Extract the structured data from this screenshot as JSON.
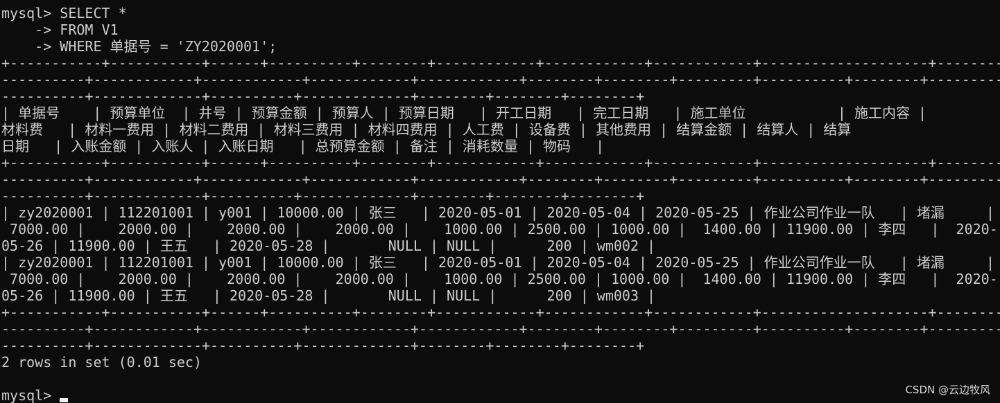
{
  "terminal": {
    "lines": [
      "mysql> SELECT *",
      "    -> FROM V1",
      "    -> WHERE 单据号 = 'ZY2020001';",
      "+-----------+-----------+------+----------+--------+------------+------------+------------+--------------------+----------+",
      "----------+------------+------------+------------+------------+--------+--------+---------+----------+--------+----------+",
      "| 单据号    | 预算单位  | 井号 | 预算金额 | 预算人 | 预算日期   | 开工日期   | 完工日期   | 施工单位           | 施工内容 |",
      "材料费   | 材料一费用 | 材料二费用 | 材料三费用 | 材料四费用 | 人工费 | 设备费 | 其他费用 | 结算金额 | 结算人 | 结算",
      "日期   | 入账金额 | 入账人 | 入账日期   | 总预算金额 | 备注 | 消耗数量 | 物码   |",
      "+-----------+-----------+------+----------+--------+------------+------------+------------+--------------------+----------+",
      "----------+------------+------------+------------+------------+--------+--------+---------+----------+--------+----------+",
      "----------+-------------+----------+-------------+--------+--------+--------+",
      "| zy2020001 | 112201001 | y001 | 10000.00 | 张三   | 2020-05-01 | 2020-05-04 | 2020-05-25 | 作业公司作业一队   | 堵漏     |",
      " 7000.00 |    2000.00 |    2000.00 |    2000.00 |    1000.00 | 2500.00 | 1000.00 |  1400.00 | 11900.00 | 李四   |  2020-",
      "05-26 | 11900.00 | 王五   | 2020-05-28 |       NULL | NULL |      200 | wm002 |",
      "| zy2020001 | 112201001 | y001 | 10000.00 | 张三   | 2020-05-01 | 2020-05-04 | 2020-05-25 | 作业公司作业一队   | 堵漏     |",
      " 7000.00 |    2000.00 |    2000.00 |    2000.00 |    1000.00 | 2500.00 | 1000.00 |  1400.00 | 11900.00 | 李四   |  2020-",
      "05-26 | 11900.00 | 王五   | 2020-05-28 |       NULL | NULL |      200 | wm003 |",
      "+-----------+-----------+------+----------+--------+------------+------------+------------+--------------------+----------+",
      "----------+------------+------------+------------+------------+--------+--------+---------+----------+--------+----------+",
      "----------+-------------+----------+-------------+--------+--------+--------+",
      "",
      "2 rows in set (0.01 sec)",
      "",
      "mysql> "
    ]
  },
  "watermark": "CSDN @云边牧风",
  "colors": {
    "background": "#0c0c0c",
    "text": "#cccccc",
    "cursor": "#f2f2f2"
  }
}
